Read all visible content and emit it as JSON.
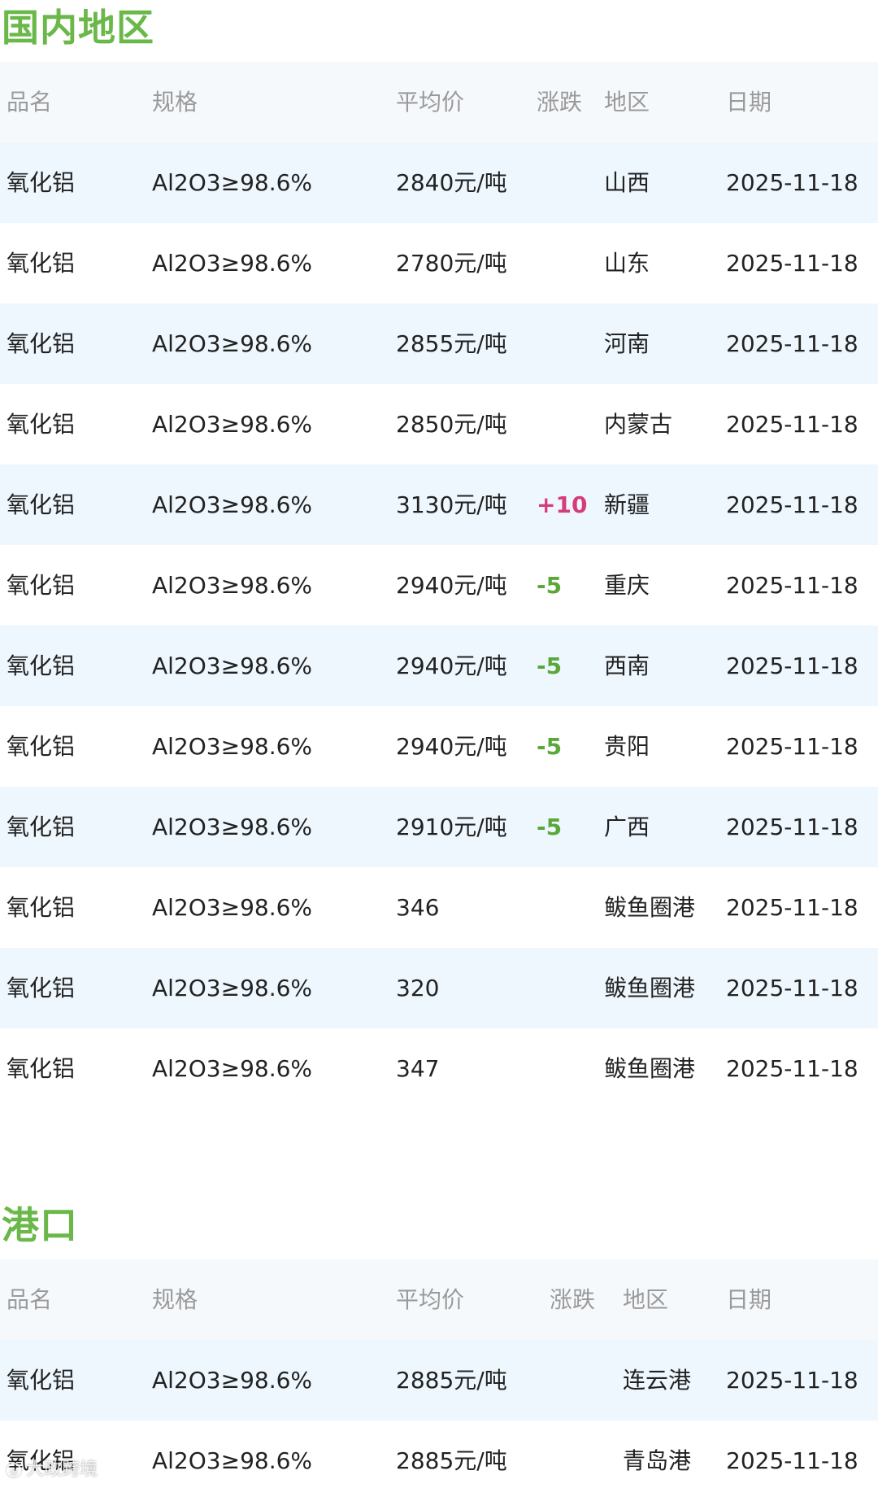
{
  "domestic": {
    "title": "国内地区",
    "headers": {
      "name": "品名",
      "spec": "规格",
      "price": "平均价",
      "change": "涨跌",
      "region": "地区",
      "date": "日期"
    },
    "rows": [
      {
        "name": "氧化铝",
        "spec": "Al2O3≥98.6%",
        "price": "2840元/吨",
        "change": "",
        "region": "山西",
        "date": "2025-11-18"
      },
      {
        "name": "氧化铝",
        "spec": "Al2O3≥98.6%",
        "price": "2780元/吨",
        "change": "",
        "region": "山东",
        "date": "2025-11-18"
      },
      {
        "name": "氧化铝",
        "spec": "Al2O3≥98.6%",
        "price": "2855元/吨",
        "change": "",
        "region": "河南",
        "date": "2025-11-18"
      },
      {
        "name": "氧化铝",
        "spec": "Al2O3≥98.6%",
        "price": "2850元/吨",
        "change": "",
        "region": "内蒙古",
        "date": "2025-11-18"
      },
      {
        "name": "氧化铝",
        "spec": "Al2O3≥98.6%",
        "price": "3130元/吨",
        "change": "+10",
        "region": "新疆",
        "date": "2025-11-18"
      },
      {
        "name": "氧化铝",
        "spec": "Al2O3≥98.6%",
        "price": "2940元/吨",
        "change": "-5",
        "region": "重庆",
        "date": "2025-11-18"
      },
      {
        "name": "氧化铝",
        "spec": "Al2O3≥98.6%",
        "price": "2940元/吨",
        "change": "-5",
        "region": "西南",
        "date": "2025-11-18"
      },
      {
        "name": "氧化铝",
        "spec": "Al2O3≥98.6%",
        "price": "2940元/吨",
        "change": "-5",
        "region": "贵阳",
        "date": "2025-11-18"
      },
      {
        "name": "氧化铝",
        "spec": "Al2O3≥98.6%",
        "price": "2910元/吨",
        "change": "-5",
        "region": "广西",
        "date": "2025-11-18"
      },
      {
        "name": "氧化铝",
        "spec": "Al2O3≥98.6%",
        "price": "346",
        "change": "",
        "region": "鲅鱼圈港",
        "date": "2025-11-18"
      },
      {
        "name": "氧化铝",
        "spec": "Al2O3≥98.6%",
        "price": "320",
        "change": "",
        "region": "鲅鱼圈港",
        "date": "2025-11-18"
      },
      {
        "name": "氧化铝",
        "spec": "Al2O3≥98.6%",
        "price": "347",
        "change": "",
        "region": "鲅鱼圈港",
        "date": "2025-11-18"
      }
    ]
  },
  "port": {
    "title": "港口",
    "headers": {
      "name": "品名",
      "spec": "规格",
      "price": "平均价",
      "change": "涨跌",
      "region": "地区",
      "date": "日期"
    },
    "rows": [
      {
        "name": "氧化铝",
        "spec": "Al2O3≥98.6%",
        "price": "2885元/吨",
        "change": "",
        "region": "连云港",
        "date": "2025-11-18"
      },
      {
        "name": "氧化铝",
        "spec": "Al2O3≥98.6%",
        "price": "2885元/吨",
        "change": "",
        "region": "青岛港",
        "date": "2025-11-18"
      }
    ]
  },
  "watermark": {
    "text": "大政跨境"
  },
  "colors": {
    "section_title": "#6bb84a",
    "row_stripe": "#eef7fd",
    "header_bg": "#f6f9fc",
    "change_up": "#d63b7a",
    "change_down": "#5aa83a",
    "header_text": "#9a9a9a"
  }
}
